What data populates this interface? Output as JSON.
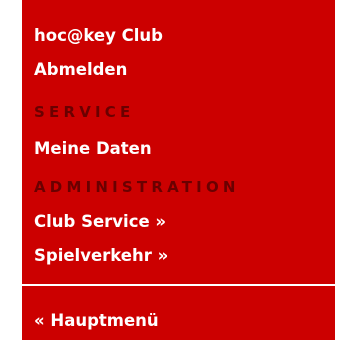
{
  "menu": {
    "club_name": "hoc@key Club",
    "logout": "Abmelden",
    "service_heading": "SERVICE",
    "my_data": "Meine Daten",
    "admin_heading": "ADMINISTRATION",
    "club_service": "Club Service »",
    "game_traffic": "Spielverkehr »",
    "main_menu": "« Hauptmenü"
  },
  "colors": {
    "menu_background": "#cc0000",
    "link_text": "#ffffff",
    "section_heading": "#6a0000",
    "separator": "#ffffff"
  }
}
